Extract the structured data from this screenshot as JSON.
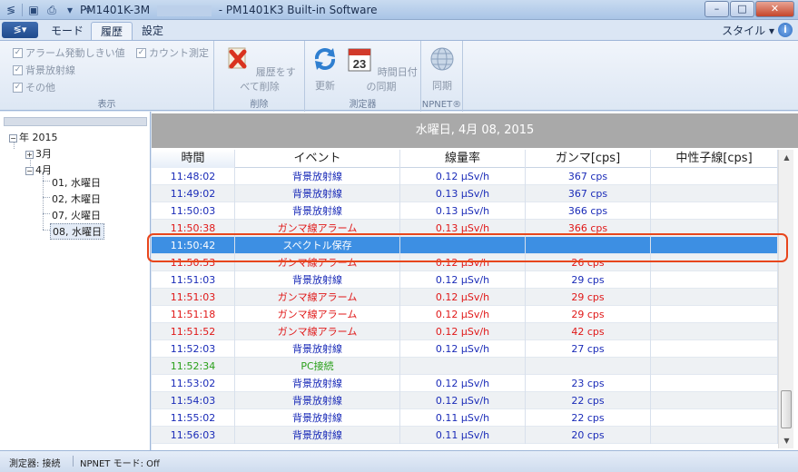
{
  "titlebar": {
    "title_left": "PM1401K-3M",
    "title_right": "- PM1401K3 Built-in Software"
  },
  "ribbon_tabs": {
    "app_menu_label": "",
    "tabs": [
      "モード",
      "履歴",
      "設定"
    ],
    "active_tab": "履歴",
    "style_label": "スタイル ▾"
  },
  "ribbon": {
    "display_group": {
      "label": "表示",
      "checkboxes": [
        "アラーム発動しきい値",
        "背景放射線",
        "その他",
        "カウント測定"
      ]
    },
    "delete_group": {
      "label": "削除",
      "button": "履歴をすべて削除"
    },
    "device_group": {
      "label": "測定器",
      "buttons": [
        "更新",
        "時間日付の同期"
      ]
    },
    "npnet_group": {
      "label": "NPNET®",
      "button": "同期"
    },
    "calendar_day": "23"
  },
  "tree": {
    "year": "年 2015",
    "months": [
      "3月",
      "4月"
    ],
    "days": [
      "01, 水曜日",
      "02, 木曜日",
      "07, 火曜日",
      "08, 水曜日"
    ],
    "selected_day": "08, 水曜日"
  },
  "banner": {
    "date": "水曜日, 4月 08, 2015"
  },
  "grid": {
    "columns": [
      "時間",
      "イベント",
      "線量率",
      "ガンマ[cps]",
      "中性子線[cps]"
    ],
    "rows": [
      {
        "time": "11:48:02",
        "event": "背景放射線",
        "dose": "0.12 μSv/h",
        "gamma": "367 cps",
        "neutron": "",
        "color": "blue"
      },
      {
        "time": "11:49:02",
        "event": "背景放射線",
        "dose": "0.13 μSv/h",
        "gamma": "367 cps",
        "neutron": "",
        "color": "blue"
      },
      {
        "time": "11:50:03",
        "event": "背景放射線",
        "dose": "0.13 μSv/h",
        "gamma": "366 cps",
        "neutron": "",
        "color": "blue"
      },
      {
        "time": "11:50:38",
        "event": "ガンマ線アラーム",
        "dose": "0.13 μSv/h",
        "gamma": "366 cps",
        "neutron": "",
        "color": "red"
      },
      {
        "time": "11:50:42",
        "event": "スペクトル保存",
        "dose": "",
        "gamma": "",
        "neutron": "",
        "color": "white",
        "selected": true
      },
      {
        "time": "11:50:53",
        "event": "ガンマ線アラーム",
        "dose": "0.12 μSv/h",
        "gamma": "26 cps",
        "neutron": "",
        "color": "red"
      },
      {
        "time": "11:51:03",
        "event": "背景放射線",
        "dose": "0.12 μSv/h",
        "gamma": "29 cps",
        "neutron": "",
        "color": "blue"
      },
      {
        "time": "11:51:03",
        "event": "ガンマ線アラーム",
        "dose": "0.12 μSv/h",
        "gamma": "29 cps",
        "neutron": "",
        "color": "red"
      },
      {
        "time": "11:51:18",
        "event": "ガンマ線アラーム",
        "dose": "0.12 μSv/h",
        "gamma": "29 cps",
        "neutron": "",
        "color": "red"
      },
      {
        "time": "11:51:52",
        "event": "ガンマ線アラーム",
        "dose": "0.12 μSv/h",
        "gamma": "42 cps",
        "neutron": "",
        "color": "red"
      },
      {
        "time": "11:52:03",
        "event": "背景放射線",
        "dose": "0.12 μSv/h",
        "gamma": "27 cps",
        "neutron": "",
        "color": "blue"
      },
      {
        "time": "11:52:34",
        "event": "PC接続",
        "dose": "",
        "gamma": "",
        "neutron": "",
        "color": "green"
      },
      {
        "time": "11:53:02",
        "event": "背景放射線",
        "dose": "0.12 μSv/h",
        "gamma": "23 cps",
        "neutron": "",
        "color": "blue"
      },
      {
        "time": "11:54:03",
        "event": "背景放射線",
        "dose": "0.12 μSv/h",
        "gamma": "22 cps",
        "neutron": "",
        "color": "blue"
      },
      {
        "time": "11:55:02",
        "event": "背景放射線",
        "dose": "0.11 μSv/h",
        "gamma": "22 cps",
        "neutron": "",
        "color": "blue"
      },
      {
        "time": "11:56:03",
        "event": "背景放射線",
        "dose": "0.11 μSv/h",
        "gamma": "20 cps",
        "neutron": "",
        "color": "blue"
      }
    ]
  },
  "statusbar": {
    "device": "測定器: 接続",
    "npnet": "NPNET モード: Off"
  },
  "colors": {
    "selection": "#3d8fe3",
    "highlight_frame": "#e8461c",
    "blue_text": "#1a2bb8",
    "red_text": "#e01818",
    "green_text": "#2aa01a"
  }
}
